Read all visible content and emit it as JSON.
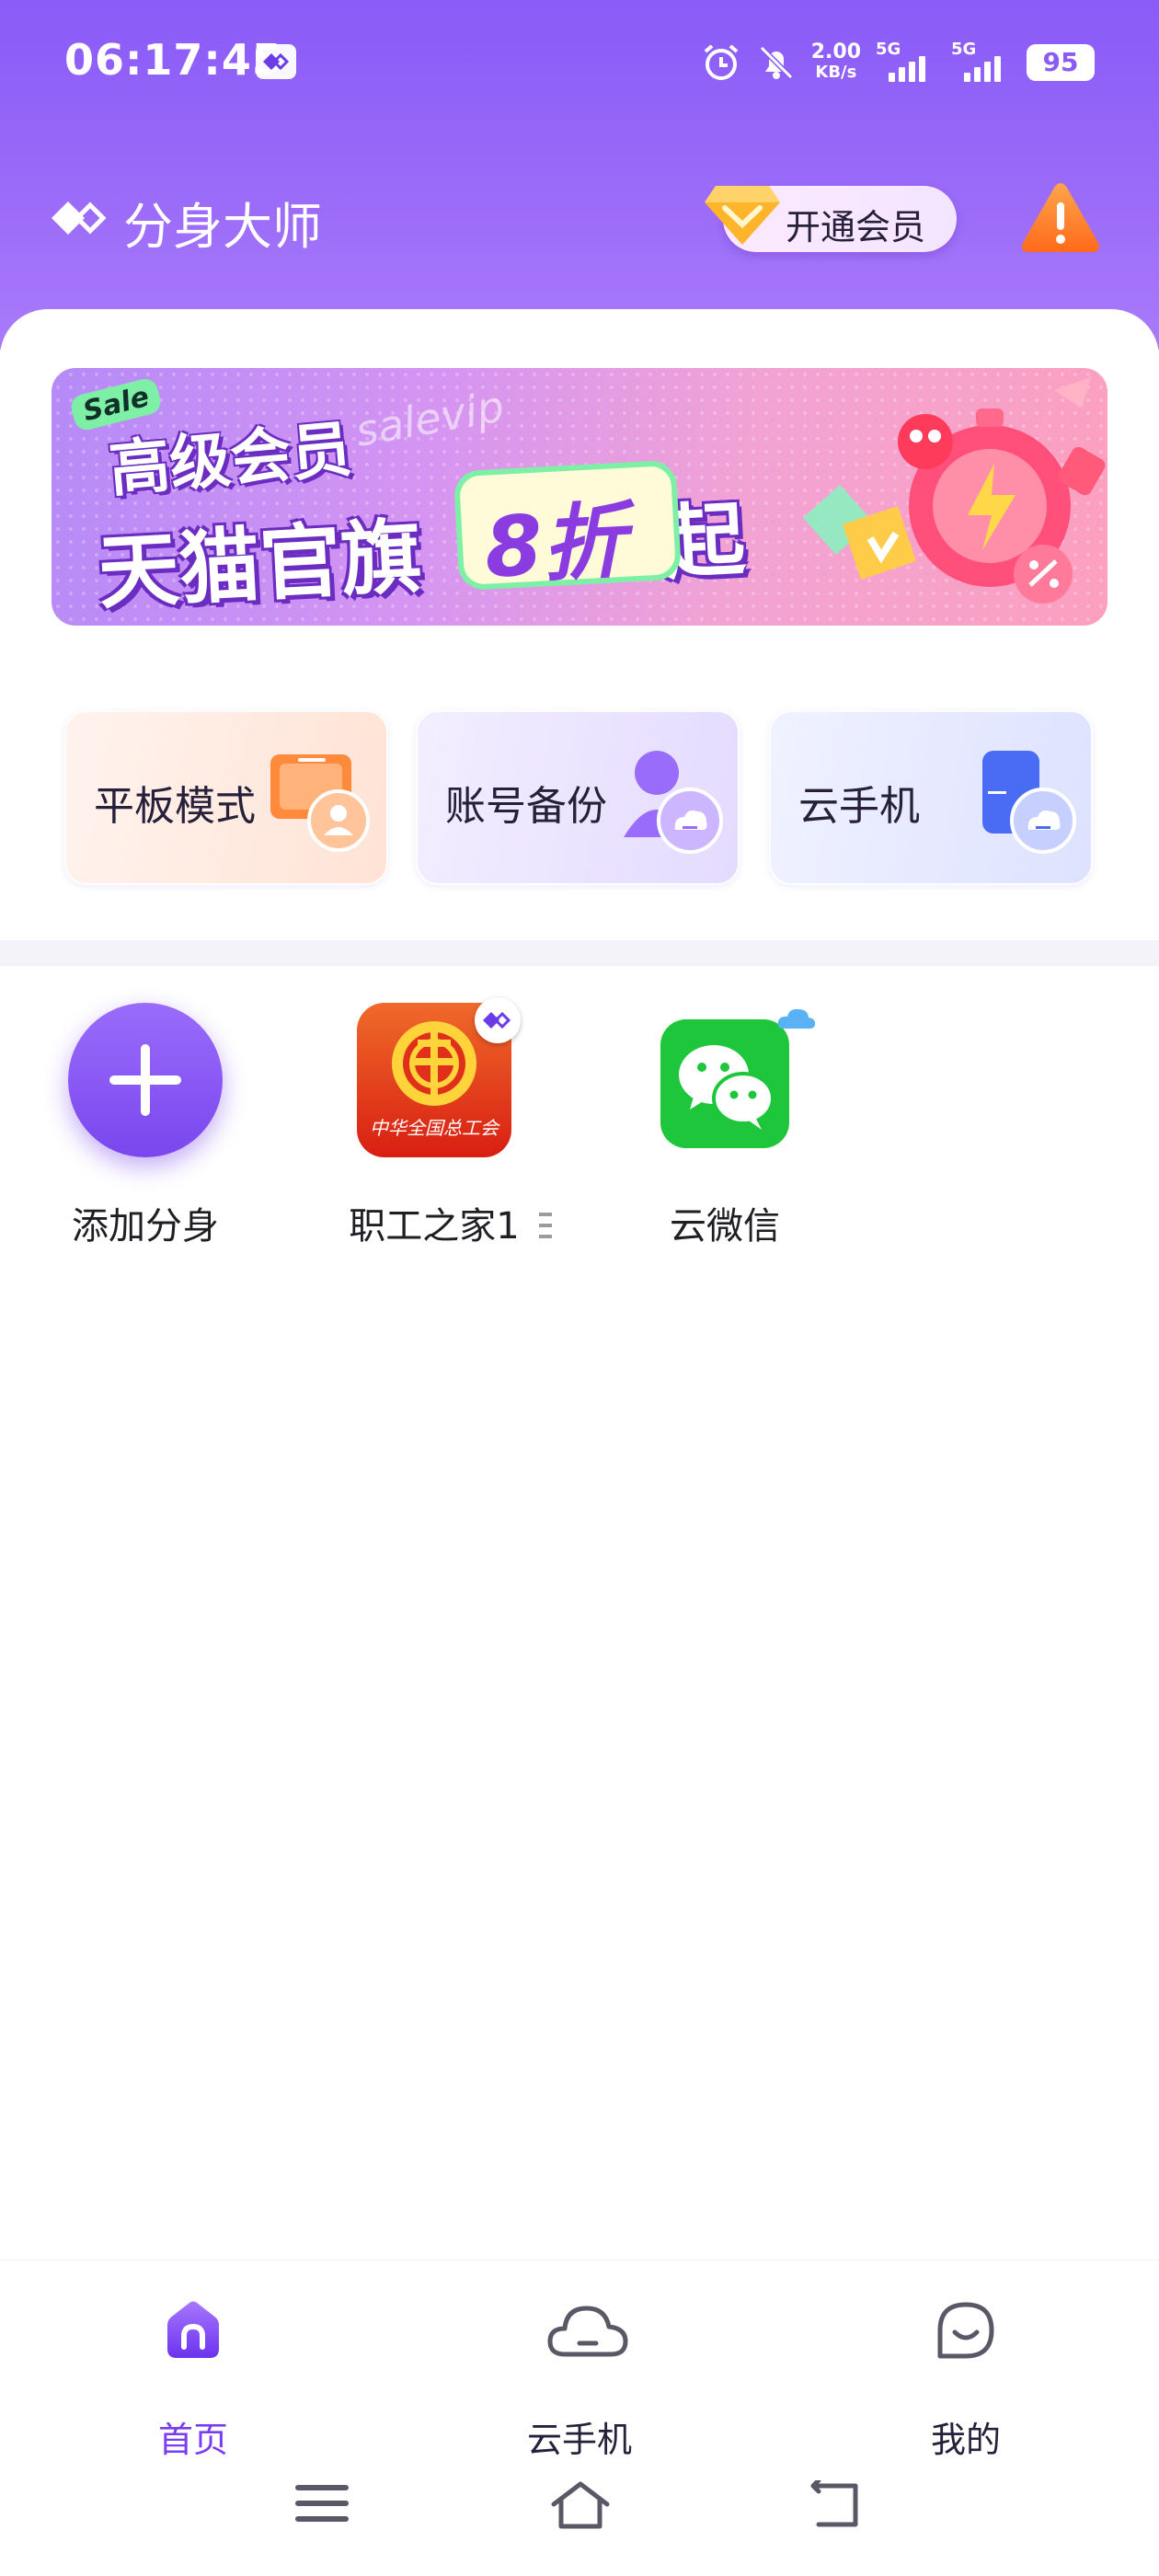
{
  "status_bar": {
    "time": "06:17:45",
    "net_speed_value": "2.00",
    "net_speed_unit": "KB/s",
    "signal_1": "5G",
    "signal_2": "5G",
    "battery": "95"
  },
  "header": {
    "title": "分身大师",
    "vip_button_label": "开通会员"
  },
  "banner": {
    "sale_tag": "Sale",
    "script_text": "salevip",
    "line1": "高级会员",
    "line2_prefix": "天猫官旗",
    "highlight": "8折",
    "line2_suffix": "起"
  },
  "features": [
    {
      "label": "平板模式"
    },
    {
      "label": "账号备份"
    },
    {
      "label": "云手机"
    }
  ],
  "apps": [
    {
      "name": "添加分身"
    },
    {
      "name": "职工之家1"
    },
    {
      "name": "云微信"
    }
  ],
  "union_icon_text": "中华全国总工会",
  "bottom_nav": [
    {
      "label": "首页",
      "active": true
    },
    {
      "label": "云手机",
      "active": false
    },
    {
      "label": "我的",
      "active": false
    }
  ],
  "colors": {
    "primary": "#8a5bf7",
    "active_nav": "#7a3cf0",
    "wechat_green": "#1dc63a"
  }
}
